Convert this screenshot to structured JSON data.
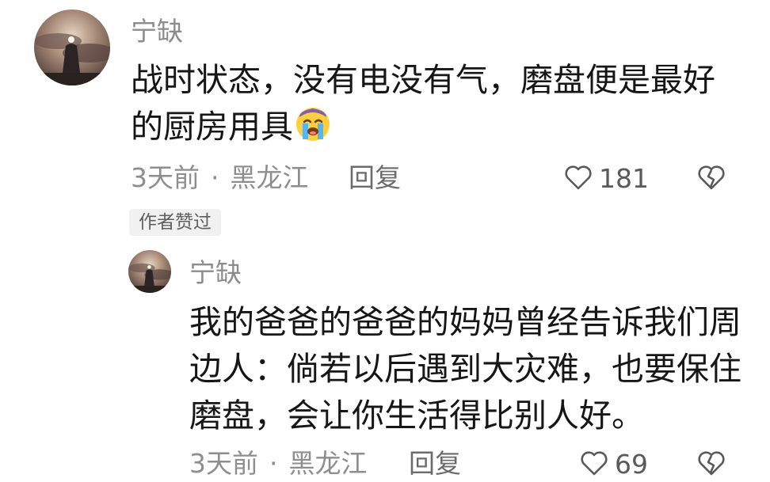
{
  "comments": [
    {
      "username": "宁缺",
      "text_lines": [
        "战时状态，没有电没有气，磨盘便是最好",
        "的厨房用具"
      ],
      "emoji_icon": "crying-face-emoji",
      "time": "3天前",
      "separator": "·",
      "location": "黑龙江",
      "reply_label": "回复",
      "like_count": "181",
      "badge": "作者赞过"
    },
    {
      "username": "宁缺",
      "text_lines": [
        "我的爸爸的爸爸的妈妈曾经告诉我们周",
        "边人：倘若以后遇到大灾难，也要保住",
        "磨盘，会让你生活得比别人好。"
      ],
      "time": "3天前",
      "separator": "·",
      "location": "黑龙江",
      "reply_label": "回复",
      "like_count": "69"
    }
  ],
  "icons": {
    "like": "heart-outline-icon",
    "dislike": "broken-heart-icon"
  },
  "colors": {
    "meta_gray": "#8e8e8e",
    "text": "#161616",
    "badge_bg": "#f1f1f1"
  }
}
